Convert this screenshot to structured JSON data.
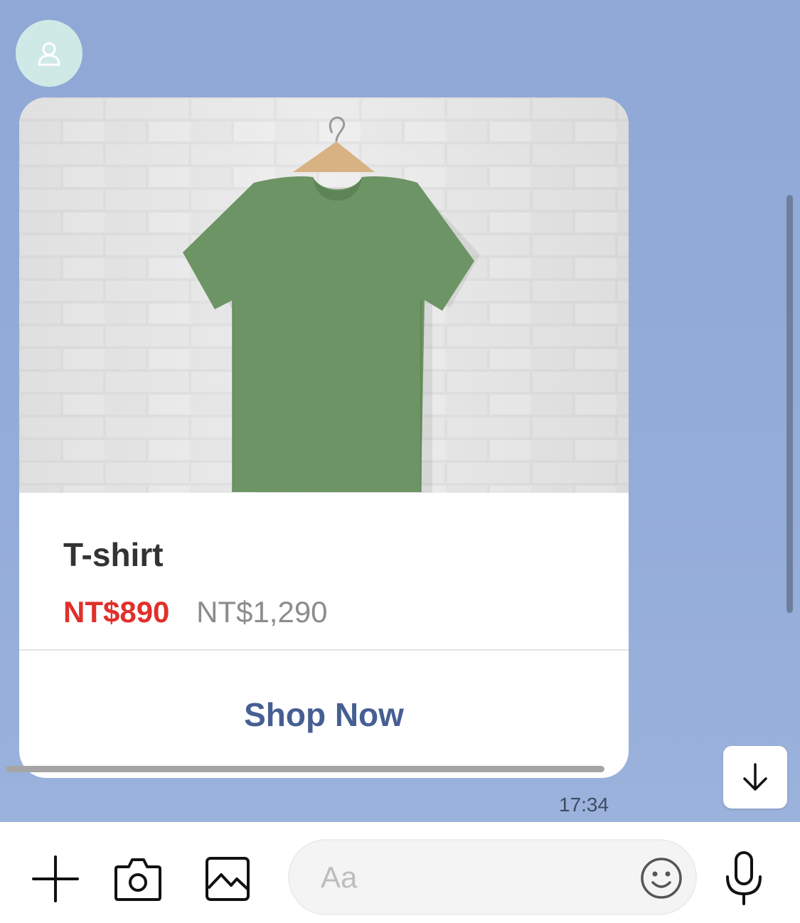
{
  "chat": {
    "avatar_icon": "user-icon",
    "card": {
      "image_alt": "green t-shirt on hanger",
      "title": "T-shirt",
      "sale_price": "NT$890",
      "original_price": "NT$1,290",
      "button_label": "Shop Now"
    },
    "timestamp": "17:34",
    "scroll_down_icon": "arrow-down-icon"
  },
  "input_bar": {
    "plus_icon": "plus-icon",
    "camera_icon": "camera-icon",
    "gallery_icon": "image-icon",
    "placeholder": "Aa",
    "emoji_icon": "smiley-icon",
    "mic_icon": "microphone-icon"
  },
  "colors": {
    "chat_background": "#91a9d6",
    "sale_price": "#e0302a",
    "original_price": "#8c8c8c",
    "button_text": "#465f93",
    "title_text": "#333333"
  }
}
